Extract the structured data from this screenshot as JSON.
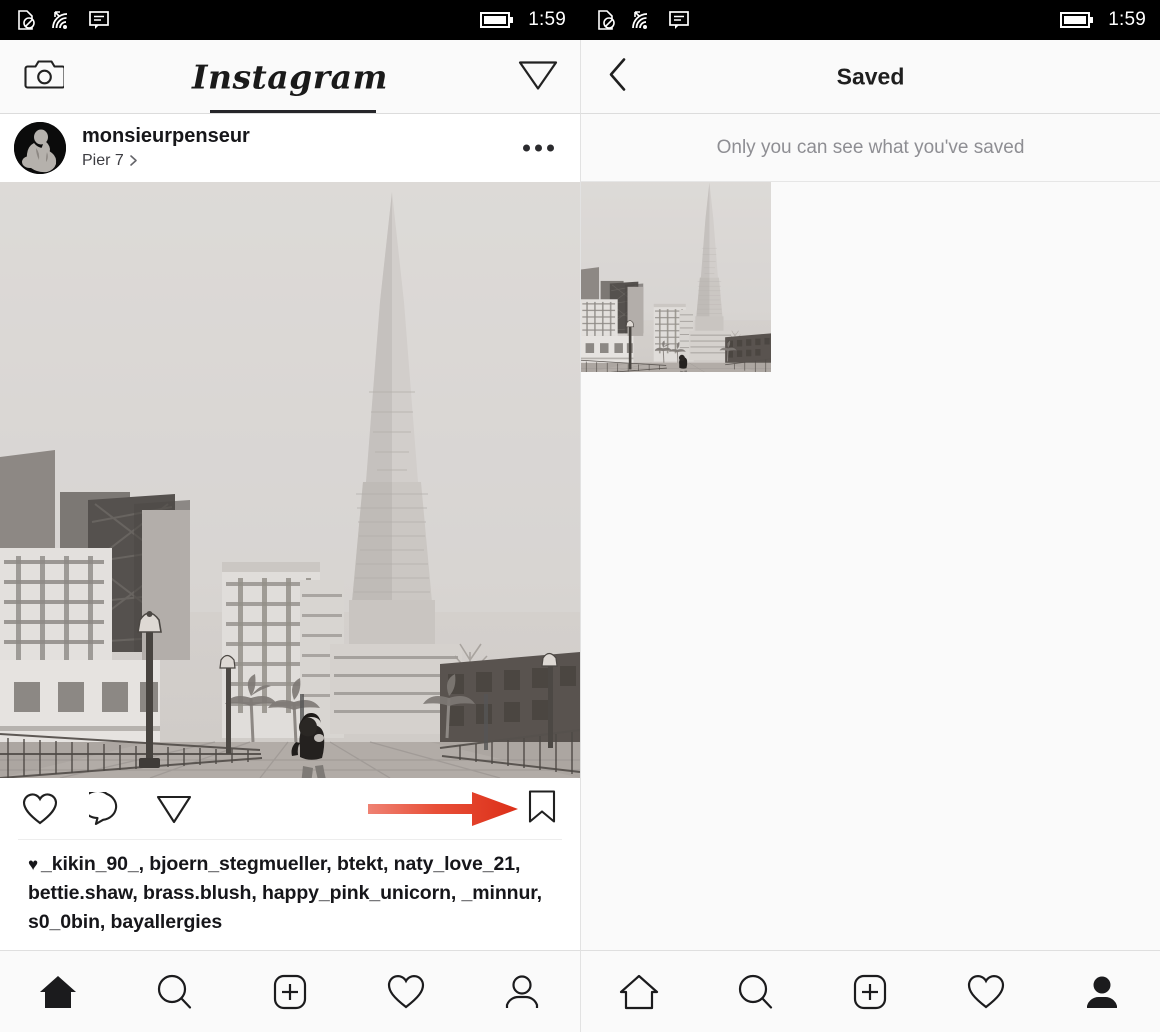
{
  "status_bar": {
    "left": {
      "icons": [
        "no-sim-icon",
        "wifi-icon",
        "sms-icon"
      ],
      "battery_icon": "battery-icon",
      "time": "1:59"
    },
    "right": {
      "icons": [
        "no-sim-icon",
        "wifi-icon",
        "sms-icon"
      ],
      "battery_icon": "battery-icon",
      "time": "1:59"
    },
    "background_color": "#000000",
    "text_color": "#ffffff"
  },
  "left_app": {
    "header": {
      "camera_icon": "camera-icon",
      "logo_text": "Instagram",
      "send_icon": "send-icon",
      "active_tab_underline": true
    },
    "post": {
      "username": "monsieurpenseur",
      "location": "Pier 7",
      "location_chevron": "chevron-right-icon",
      "more_options": "ellipsis-icon",
      "avatar_alt": "the-thinker-statue-avatar",
      "photo_alt": "black-and-white-photo-pier-7-transamerica-pyramid",
      "actions": {
        "like": "heart-icon",
        "comment": "comment-icon",
        "share": "send-icon",
        "save": "bookmark-icon"
      },
      "annotation": {
        "type": "red-arrow",
        "points_to": "bookmark-icon",
        "color": "#E63119",
        "color_light": "#F08070"
      },
      "likes_heart": "♥",
      "likes_text": "_kikin_90_, bjoern_stegmueller, btekt, naty_love_21, bettie.shaw, brass.blush, happy_pink_unicorn, _minnur, s0_0bin, bayallergies"
    },
    "tab_bar": {
      "items": [
        {
          "name": "home",
          "icon": "home-icon",
          "active": true
        },
        {
          "name": "search",
          "icon": "search-icon",
          "active": false
        },
        {
          "name": "add",
          "icon": "plus-square-icon",
          "active": false
        },
        {
          "name": "activity",
          "icon": "heart-icon",
          "active": false
        },
        {
          "name": "profile",
          "icon": "person-icon",
          "active": false
        }
      ]
    }
  },
  "right_app": {
    "header": {
      "back_icon": "chevron-left-icon",
      "title": "Saved"
    },
    "note": "Only you can see what you've saved",
    "saved_items": [
      {
        "alt": "saved-photo-pier-7-transamerica-pyramid"
      }
    ],
    "tab_bar": {
      "items": [
        {
          "name": "home",
          "icon": "home-icon",
          "active": false
        },
        {
          "name": "search",
          "icon": "search-icon",
          "active": false
        },
        {
          "name": "add",
          "icon": "plus-square-icon",
          "active": false
        },
        {
          "name": "activity",
          "icon": "heart-icon",
          "active": false
        },
        {
          "name": "profile",
          "icon": "person-icon",
          "active": true
        }
      ]
    }
  }
}
